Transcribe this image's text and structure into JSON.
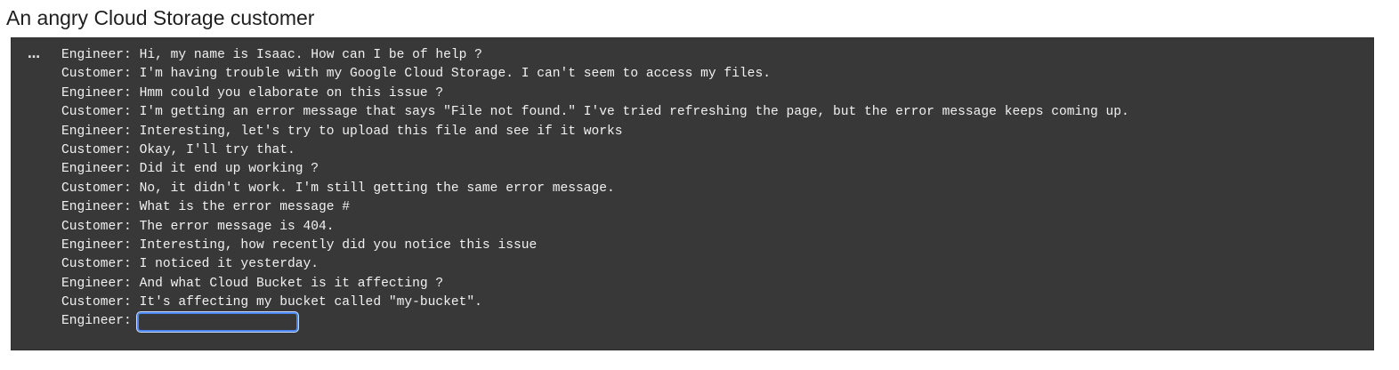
{
  "heading": "An angry Cloud Storage customer",
  "output": {
    "ellipsis": "…",
    "lines": [
      {
        "speaker": "Engineer:",
        "text": " Hi, my name is Isaac. How can I be of help ?"
      },
      {
        "speaker": "Customer:",
        "text": " I'm having trouble with my Google Cloud Storage. I can't seem to access my files."
      },
      {
        "speaker": "Engineer:",
        "text": " Hmm could you elaborate on this issue ?"
      },
      {
        "speaker": "Customer:",
        "text": " I'm getting an error message that says \"File not found.\" I've tried refreshing the page, but the error message keeps coming up."
      },
      {
        "speaker": "Engineer:",
        "text": " Interesting, let's try to upload this file and see if it works"
      },
      {
        "speaker": "Customer:",
        "text": " Okay, I'll try that."
      },
      {
        "speaker": "Engineer:",
        "text": " Did it end up working ?"
      },
      {
        "speaker": "Customer:",
        "text": " No, it didn't work. I'm still getting the same error message."
      },
      {
        "speaker": "Engineer:",
        "text": " What is the error message #"
      },
      {
        "speaker": "Customer:",
        "text": " The error message is 404."
      },
      {
        "speaker": "Engineer:",
        "text": " Interesting, how recently did you notice this issue"
      },
      {
        "speaker": "Customer:",
        "text": " I noticed it yesterday."
      },
      {
        "speaker": "Engineer:",
        "text": " And what Cloud Bucket is it affecting ?"
      },
      {
        "speaker": "Customer:",
        "text": " It's affecting my bucket called \"my-bucket\"."
      }
    ],
    "prompt": {
      "speaker": "Engineer:",
      "value": ""
    }
  },
  "colors": {
    "panel_background": "#383838",
    "text": "#f1f1f1",
    "input_focus_border": "#4c86f0"
  }
}
